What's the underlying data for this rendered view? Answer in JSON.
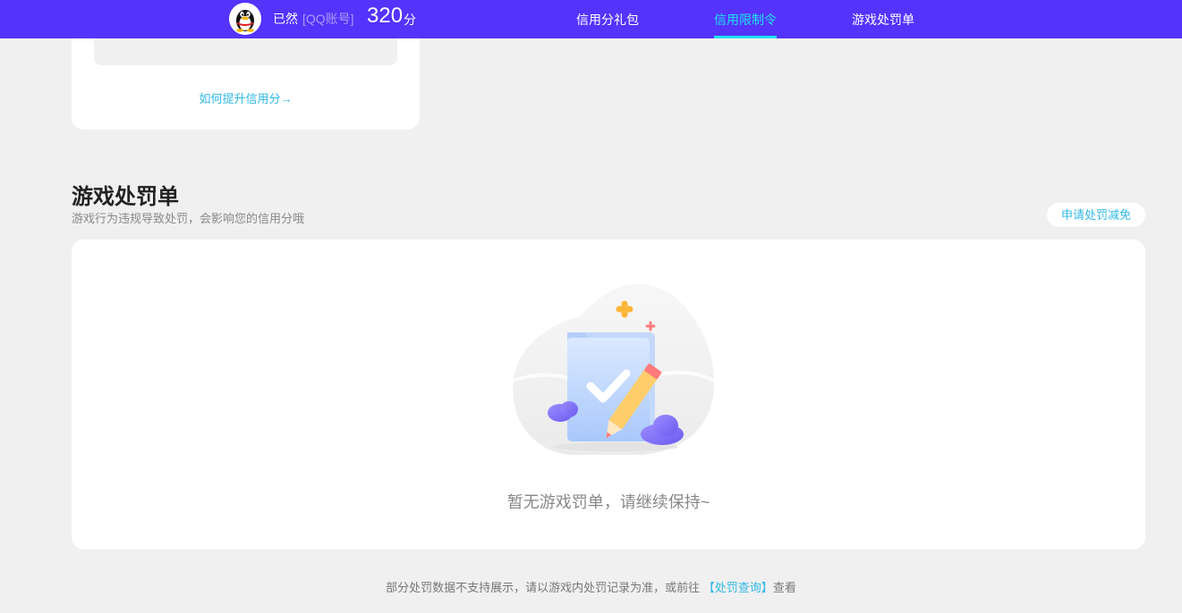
{
  "header": {
    "username": "已然",
    "account_tag": "[QQ账号]",
    "score": "320",
    "score_unit": "分",
    "tabs": [
      {
        "label": "信用分礼包",
        "active": false
      },
      {
        "label": "信用限制令",
        "active": true
      },
      {
        "label": "游戏处罚单",
        "active": false
      }
    ]
  },
  "credit_card": {
    "improve_link": "如何提升信用分→"
  },
  "penalty_section": {
    "title": "游戏处罚单",
    "subtitle": "游戏行为违规导致处罚，会影响您的信用分哦",
    "apply_button": "申请处罚减免",
    "empty_text": "暂无游戏罚单，请继续保持~"
  },
  "footer": {
    "note_prefix": "部分处罚数据不支持展示，请以游戏内处罚记录为准，或前往",
    "note_link": "【处罚查询】",
    "note_suffix": "查看"
  },
  "colors": {
    "brand": "#5433fb",
    "accent": "#1ee2f2",
    "link": "#2fb9e6",
    "background": "#f0f0f0"
  },
  "icons": {
    "avatar": "qq-penguin-icon",
    "empty_state": "folder-check-pencil-illustration"
  }
}
